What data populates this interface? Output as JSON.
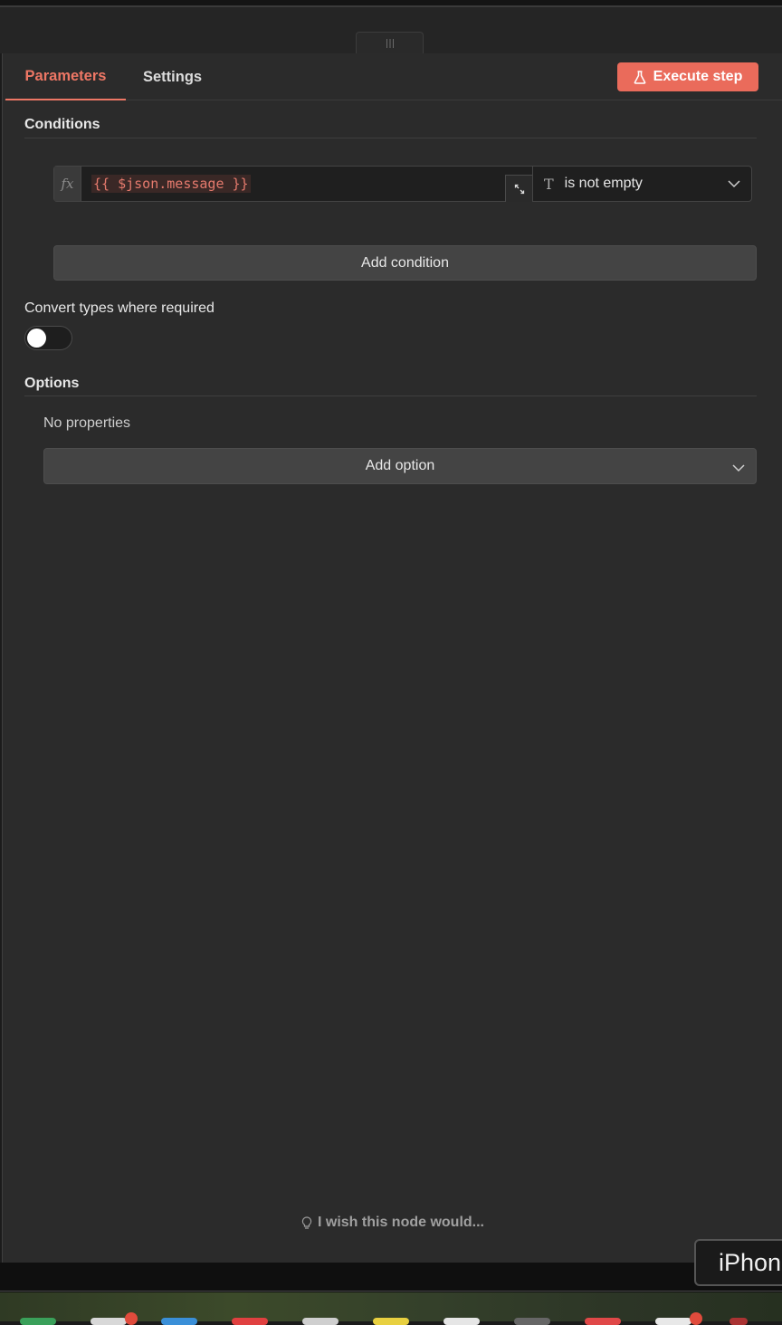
{
  "tabs": [
    {
      "label": "Parameters",
      "active": true
    },
    {
      "label": "Settings",
      "active": false
    }
  ],
  "execute_button": {
    "label": "Execute step",
    "icon": "flask-icon"
  },
  "conditions": {
    "title": "Conditions",
    "rows": [
      {
        "expression": "{{ $json.message }}",
        "type_icon": "T",
        "operator": "is not empty"
      }
    ],
    "add_label": "Add condition"
  },
  "convert_types": {
    "label": "Convert types where required",
    "enabled": false
  },
  "options": {
    "title": "Options",
    "empty_text": "No properties",
    "add_label": "Add option"
  },
  "feedback": {
    "label": "I wish this node would..."
  },
  "tooltip": {
    "label": "iPhon"
  },
  "colors": {
    "accent": "#ea6b5b",
    "panel_bg": "#2b2b2b",
    "button_bg": "#444444"
  }
}
